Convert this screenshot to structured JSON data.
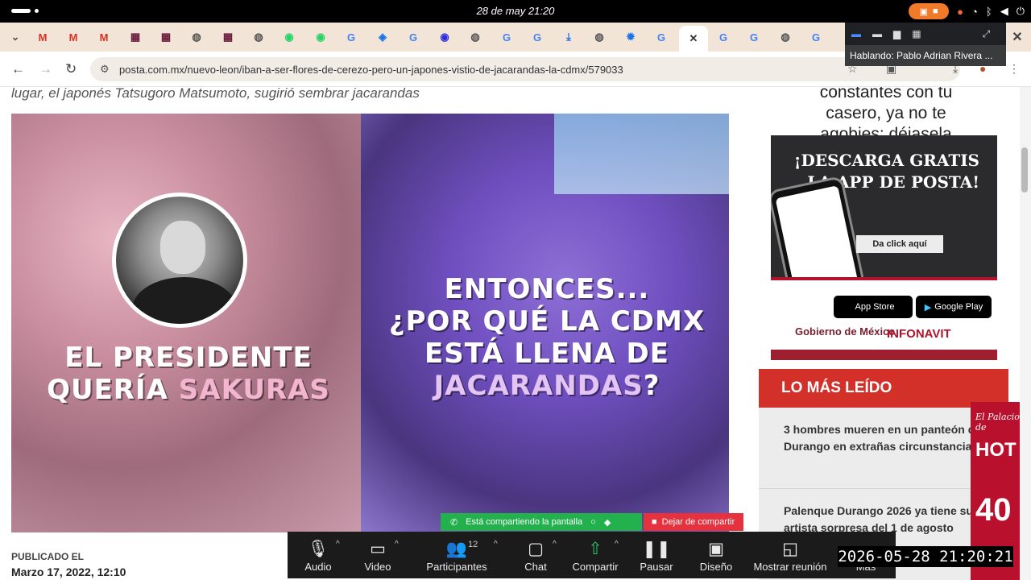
{
  "system_bar": {
    "clock": "28 de may  21:20"
  },
  "browser": {
    "url": "posta.com.mx/nuevo-leon/iban-a-ser-flores-de-cerezo-pero-un-japones-vistio-de-jacarandas-la-cdmx/579033",
    "active_tab_close": "✕"
  },
  "meeting_popup": {
    "speaker": "Hablando: Pablo Adrian Rivera ..."
  },
  "article": {
    "caption": "lugar, el japonés Tatsugoro Matsumoto, sugirió sembrar jacarandas",
    "hero_left_line1": "EL PRESIDENTE",
    "hero_left_line2_a": "QUERÍA ",
    "hero_left_line2_b": "SAKURAS",
    "hero_right_line1": "ENTONCES...",
    "hero_right_line2": "¿POR QUÉ LA CDMX",
    "hero_right_line3": "ESTÁ LLENA DE",
    "hero_right_line4_a": "JACARANDAS",
    "hero_right_line4_b": "?",
    "published_label": "PUBLICADO EL",
    "published_date": "Marzo 17, 2022, 12:10"
  },
  "sidebar": {
    "overflow_text": "constantes con tu casero, ya no te agobies: déjasela",
    "ad": {
      "title": "¡DESCARGA GRATIS LA APP DE POSTA!",
      "button": "Da click aquí",
      "appstore": "App Store",
      "googleplay": "Google Play",
      "gov": "Gobierno de México",
      "infonavit": "INFONAVIT"
    },
    "most_read_title": "LO MÁS LEÍDO",
    "most_read": [
      "3 hombres mueren en un panteón de Durango en extrañas circunstancias",
      "Palenque Durango 2026 ya tiene su artista sorpresa del 1 de agosto"
    ],
    "side_ad": {
      "brand": "El Palacio de",
      "hot": "HOT",
      "big": "40"
    }
  },
  "share_bar": {
    "sharing": "Está compartiendo la pantalla",
    "stop": "Dejar de compartir"
  },
  "zoom_toolbar": {
    "audio": "Audio",
    "video": "Video",
    "participants": "Participantes",
    "participants_count": "12",
    "chat": "Chat",
    "share": "Compartir",
    "pause": "Pausar",
    "design": "Diseño",
    "show_meeting": "Mostrar reunión",
    "more": "Más"
  },
  "timestamp": "2026-05-28  21:20:21"
}
